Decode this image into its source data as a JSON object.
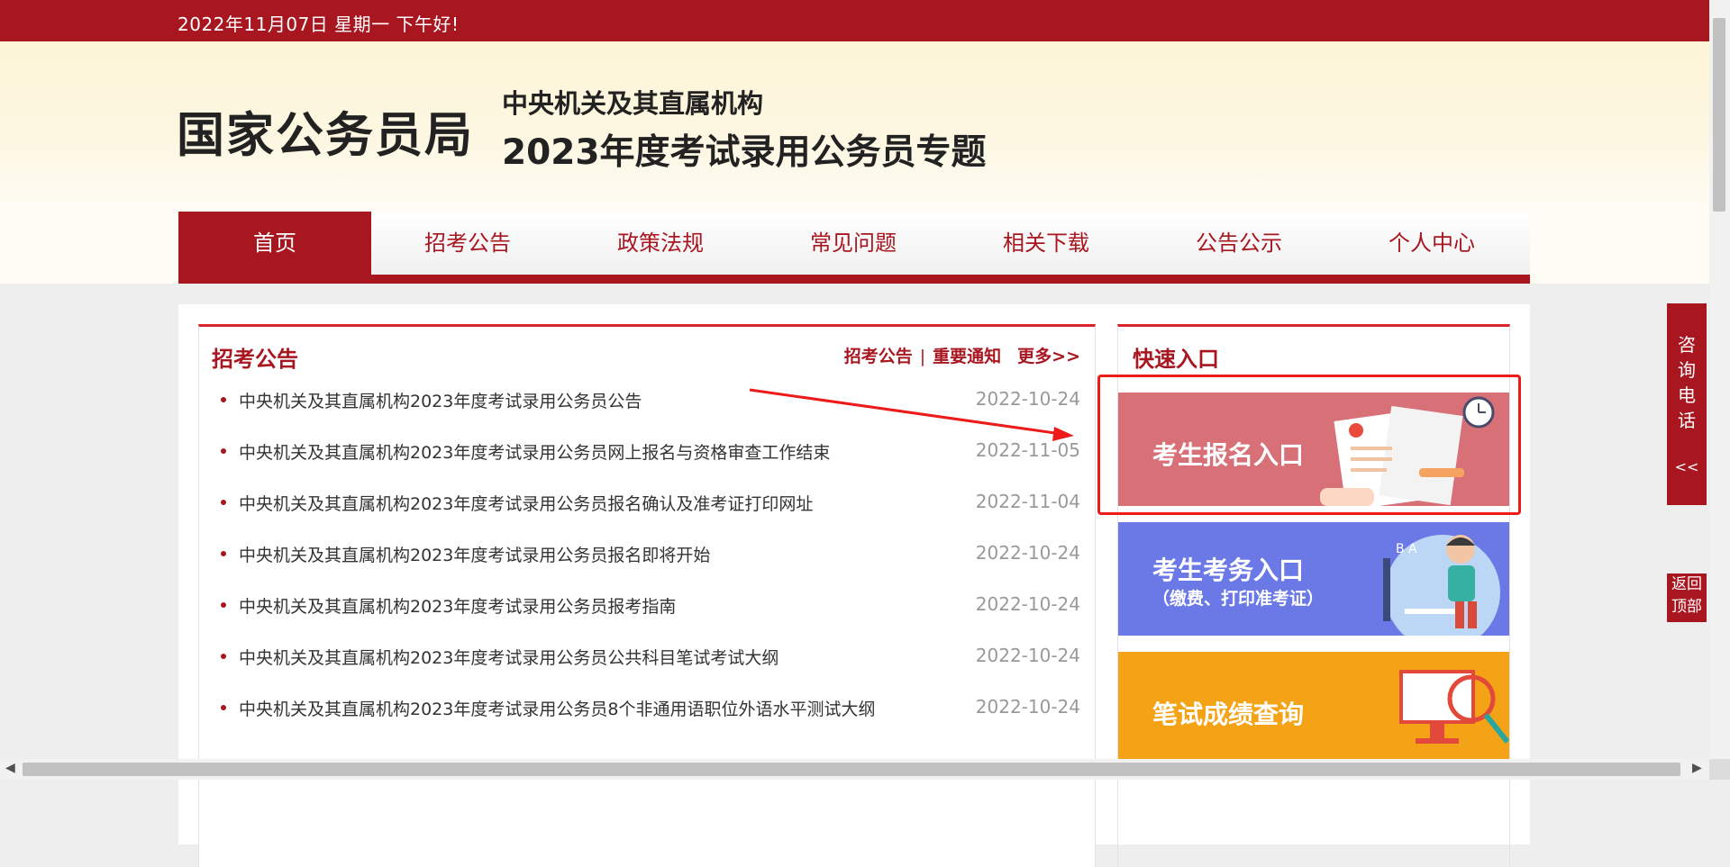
{
  "topbar": {
    "date_text": "2022年11月07日  星期一  下午好!"
  },
  "header": {
    "logo": "国家公务员局",
    "subtitle1": "中央机关及其直属机构",
    "subtitle2": "2023年度考试录用公务员专题"
  },
  "nav": {
    "items": [
      {
        "label": "首页",
        "active": true
      },
      {
        "label": "招考公告"
      },
      {
        "label": "政策法规"
      },
      {
        "label": "常见问题"
      },
      {
        "label": "相关下载"
      },
      {
        "label": "公告公示"
      },
      {
        "label": "个人中心"
      }
    ]
  },
  "news": {
    "title": "招考公告",
    "link1": "招考公告",
    "separator": "|",
    "link2": "重要通知",
    "more": "更多>>",
    "items": [
      {
        "text": "中央机关及其直属机构2023年度考试录用公务员公告",
        "date": "2022-10-24"
      },
      {
        "text": "中央机关及其直属机构2023年度考试录用公务员网上报名与资格审查工作结束",
        "date": "2022-11-05"
      },
      {
        "text": "中央机关及其直属机构2023年度考试录用公务员报名确认及准考证打印网址",
        "date": "2022-11-04"
      },
      {
        "text": "中央机关及其直属机构2023年度考试录用公务员报名即将开始",
        "date": "2022-10-24"
      },
      {
        "text": "中央机关及其直属机构2023年度考试录用公务员报考指南",
        "date": "2022-10-24"
      },
      {
        "text": "中央机关及其直属机构2023年度考试录用公务员公共科目笔试考试大纲",
        "date": "2022-10-24"
      },
      {
        "text": "中央机关及其直属机构2023年度考试录用公务员8个非通用语职位外语水平测试大纲",
        "date": "2022-10-24"
      }
    ]
  },
  "quick": {
    "title": "快速入口",
    "card1": {
      "label": "考生报名入口"
    },
    "card2": {
      "label": "考生考务入口",
      "sublabel": "（缴费、打印准考证）"
    },
    "card3": {
      "label": "笔试成绩查询"
    }
  },
  "side": {
    "consult_chars": [
      "咨",
      "询",
      "电",
      "话"
    ],
    "consult_chevron": "<<",
    "back_top_line1": "返回",
    "back_top_line2": "顶部"
  },
  "colors": {
    "brand_red": "#a81620",
    "card1_bg": "#d87078",
    "card2_bg": "#6b79e6",
    "card3_bg": "#f5a316",
    "highlight_red": "#ee1b1b"
  }
}
